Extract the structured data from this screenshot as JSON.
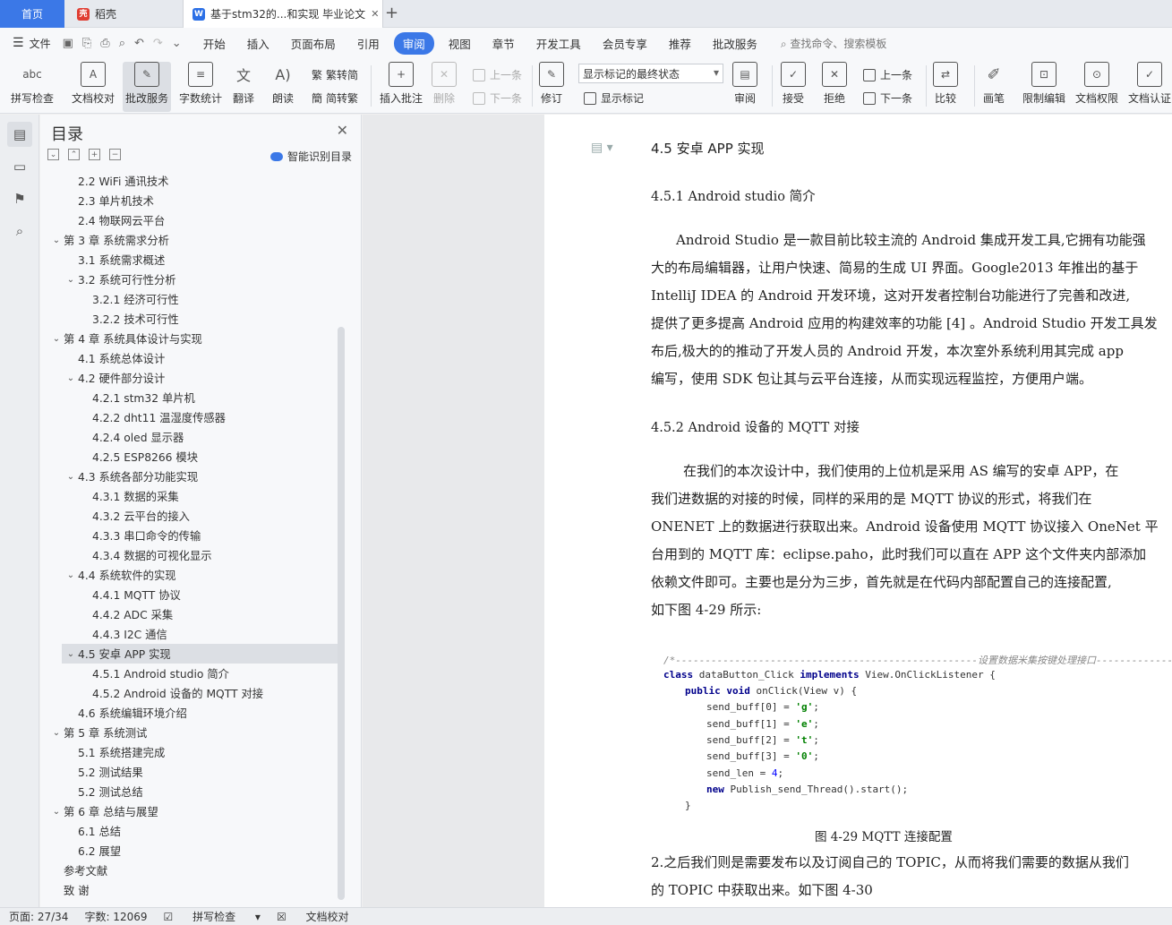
{
  "tabs": {
    "home": "首页",
    "daoke": "稻壳",
    "doc": "基于stm32的...和实现 毕业论文",
    "new": "+"
  },
  "menu": {
    "file": "文件",
    "items": [
      "开始",
      "插入",
      "页面布局",
      "引用",
      "审阅",
      "视图",
      "章节",
      "开发工具",
      "会员专享",
      "推荐",
      "批改服务"
    ],
    "active": "审阅",
    "search": "查找命令、搜索模板"
  },
  "ribbon": {
    "spell": "拼写检查",
    "proof": "文档校对",
    "review_service": "批改服务",
    "wordcount": "字数统计",
    "translate": "翻译",
    "read": "朗读",
    "to_trad": "繁转简",
    "to_simp": "简转繁",
    "insert_comment": "插入批注",
    "delete": "删除",
    "prev": "上一条",
    "next": "下一条",
    "revise": "修订",
    "combo": "显示标记的最终状态",
    "show_marks": "显示标记",
    "review": "审阅",
    "accept": "接受",
    "reject": "拒绝",
    "prev2": "上一条",
    "next2": "下一条",
    "compare": "比较",
    "pen": "画笔",
    "restrict": "限制编辑",
    "permission": "文档权限",
    "certify": "文档认证"
  },
  "toc": {
    "title": "目录",
    "smart": "智能识别目录",
    "items": [
      {
        "label": "2.2 WiFi 通讯技术",
        "level": 2,
        "arrow": ""
      },
      {
        "label": "2.3  单片机技术",
        "level": 2,
        "arrow": ""
      },
      {
        "label": "2.4  物联网云平台",
        "level": 2,
        "arrow": ""
      },
      {
        "label": "第 3 章  系统需求分析",
        "level": 1,
        "arrow": "⌄"
      },
      {
        "label": "3.1  系统需求概述",
        "level": 2,
        "arrow": ""
      },
      {
        "label": "3.2  系统可行性分析",
        "level": 2,
        "arrow": "⌄"
      },
      {
        "label": "3.2.1  经济可行性",
        "level": 3,
        "arrow": ""
      },
      {
        "label": "3.2.2  技术可行性",
        "level": 3,
        "arrow": ""
      },
      {
        "label": "第 4 章  系统具体设计与实现",
        "level": 1,
        "arrow": "⌄"
      },
      {
        "label": "4.1  系统总体设计",
        "level": 2,
        "arrow": ""
      },
      {
        "label": "4.2  硬件部分设计",
        "level": 2,
        "arrow": "⌄"
      },
      {
        "label": "4.2.1 stm32 单片机",
        "level": 3,
        "arrow": ""
      },
      {
        "label": "4.2.2 dht11 温湿度传感器",
        "level": 3,
        "arrow": ""
      },
      {
        "label": "4.2.4 oled 显示器",
        "level": 3,
        "arrow": ""
      },
      {
        "label": "4.2.5 ESP8266 模块",
        "level": 3,
        "arrow": ""
      },
      {
        "label": "4.3  系统各部分功能实现",
        "level": 2,
        "arrow": "⌄"
      },
      {
        "label": "4.3.1 数据的采集",
        "level": 3,
        "arrow": ""
      },
      {
        "label": "4.3.2 云平台的接入",
        "level": 3,
        "arrow": ""
      },
      {
        "label": "4.3.3  串口命令的传输",
        "level": 3,
        "arrow": ""
      },
      {
        "label": "4.3.4 数据的可视化显示",
        "level": 3,
        "arrow": ""
      },
      {
        "label": "4.4  系统软件的实现",
        "level": 2,
        "arrow": "⌄"
      },
      {
        "label": "4.4.1 MQTT 协议",
        "level": 3,
        "arrow": ""
      },
      {
        "label": "4.4.2 ADC 采集",
        "level": 3,
        "arrow": ""
      },
      {
        "label": "4.4.3 I2C 通信",
        "level": 3,
        "arrow": ""
      },
      {
        "label": "4.5  安卓 APP 实现",
        "level": 2,
        "arrow": "⌄",
        "active": true
      },
      {
        "label": "4.5.1 Android studio 简介",
        "level": 3,
        "arrow": ""
      },
      {
        "label": "4.5.2 Android 设备的 MQTT 对接",
        "level": 3,
        "arrow": ""
      },
      {
        "label": "4.6  系统编辑环境介绍",
        "level": 2,
        "arrow": ""
      },
      {
        "label": "第 5 章  系统测试",
        "level": 1,
        "arrow": "⌄"
      },
      {
        "label": "5.1  系统搭建完成",
        "level": 2,
        "arrow": ""
      },
      {
        "label": "5.2  测试结果",
        "level": 2,
        "arrow": ""
      },
      {
        "label": "5.2  测试总结",
        "level": 2,
        "arrow": ""
      },
      {
        "label": "第 6 章  总结与展望",
        "level": 1,
        "arrow": "⌄"
      },
      {
        "label": "6.1  总结",
        "level": 2,
        "arrow": ""
      },
      {
        "label": "6.2  展望",
        "level": 2,
        "arrow": ""
      },
      {
        "label": "参考文献",
        "level": 1,
        "arrow": ""
      },
      {
        "label": "致  谢",
        "level": 1,
        "arrow": ""
      }
    ]
  },
  "doc": {
    "h45": "4.5  安卓 APP 实现",
    "h451": "4.5.1 Android studio 简介",
    "p1": [
      "Android Studio 是一款目前比较主流的 Android 集成开发工具,它拥有功能强",
      "大的布局编辑器，让用户快速、简易的生成 UI 界面。Google2013 年推出的基于",
      "IntelliJ IDEA 的 Android 开发环境，这对开发者控制台功能进行了完善和改进,",
      "提供了更多提高 Android 应用的构建效率的功能 [4] 。Android Studio 开发工具发",
      "布后,极大的的推动了开发人员的 Android 开发，本次室外系统利用其完成 app",
      "编写，使用 SDK 包让其与云平台连接，从而实现远程监控，方便用户端。"
    ],
    "h452": "4.5.2 Android 设备的 MQTT 对接",
    "p2": [
      "在我们的本次设计中，我们使用的上位机是采用 AS 编写的安卓 APP，在",
      "我们进数据的对接的时候，同样的采用的是 MQTT 协议的形式，将我们在",
      "ONENET 上的数据进行获取出来。Android 设备使用 MQTT 协议接入 OneNet 平",
      "台用到的 MQTT 库：eclipse.paho，此时我们可以直在 APP 这个文件夹内部添加",
      "依赖文件即可。主要也是分为三步，首先就是在代码内部配置自己的连接配置,",
      "如下图 4-29  所示:"
    ],
    "code": {
      "comment": "/*---------------------------------------------------设置数据米集按键处理接口-------------------",
      "l1a": "class",
      "l1b": " dataButton_Click ",
      "l1c": "implements",
      "l1d": " View.OnClickListener {",
      "l2a": "public void",
      "l2b": " onClick(View v) {",
      "l3": "send_buff[0] = ",
      "l3s": "'g'",
      "l3e": ";",
      "l4": "send_buff[1] = ",
      "l4s": "'e'",
      "l4e": ";",
      "l5": "send_buff[2] = ",
      "l5s": "'t'",
      "l5e": ";",
      "l6": "send_buff[3] = ",
      "l6s": "'0'",
      "l6e": ";",
      "l7": "send_len = ",
      "l7n": "4",
      "l7e": ";",
      "l8a": "new",
      "l8b": " Publish_send_Thread().start();",
      "l9": "}"
    },
    "caption": "图  4-29 MQTT 连接配置",
    "p3": [
      "2.之后我们则是需要发布以及订阅自己的 TOPIC，从而将我们需要的数据从我们",
      "的 TOPIC 中获取出来。如下图 4-30"
    ]
  },
  "status": {
    "page": "页面: 27/34",
    "words": "字数: 12069",
    "spell": "拼写检查",
    "proof": "文档校对"
  }
}
